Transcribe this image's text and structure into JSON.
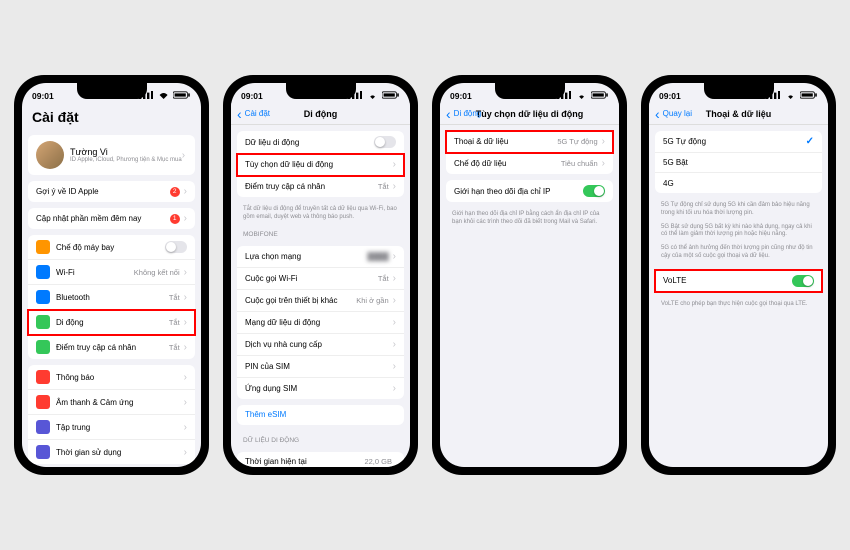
{
  "status": {
    "time": "09:01"
  },
  "phone1": {
    "title": "Cài đặt",
    "profile": {
      "name": "Tường Vi",
      "sub": "ID Apple, iCloud, Phương tiện & Mục mua"
    },
    "suggest": {
      "label": "Gợi ý về ID Apple",
      "badge": "2"
    },
    "update": {
      "label": "Cập nhật phần mềm đêm nay",
      "badge": "1"
    },
    "items": [
      {
        "label": "Chế độ máy bay",
        "icon_bg": "#ff9500"
      },
      {
        "label": "Wi-Fi",
        "detail": "Không kết nối",
        "icon_bg": "#007aff"
      },
      {
        "label": "Bluetooth",
        "detail": "Tắt",
        "icon_bg": "#007aff"
      },
      {
        "label": "Di động",
        "detail": "Tắt",
        "icon_bg": "#34c759",
        "highlight": true
      },
      {
        "label": "Điểm truy cập cá nhân",
        "detail": "Tắt",
        "icon_bg": "#34c759"
      }
    ],
    "items2": [
      {
        "label": "Thông báo",
        "icon_bg": "#ff3b30"
      },
      {
        "label": "Âm thanh & Cảm ứng",
        "icon_bg": "#ff3b30"
      },
      {
        "label": "Tập trung",
        "icon_bg": "#5856d6"
      },
      {
        "label": "Thời gian sử dụng",
        "icon_bg": "#5856d6"
      }
    ]
  },
  "phone2": {
    "back": "Cài đặt",
    "title": "Di động",
    "items_top": [
      {
        "label": "Dữ liệu di động",
        "toggle": false
      },
      {
        "label": "Tùy chọn dữ liệu di động",
        "highlight": true
      },
      {
        "label": "Điểm truy cập cá nhân",
        "detail": "Tắt"
      }
    ],
    "foot1": "Tắt dữ liệu di động để truyền tất cả dữ liệu qua Wi-Fi, bao gồm email, duyệt web và thông báo push.",
    "section": "MOBIFONE",
    "items_mob": [
      {
        "label": "Lựa chọn mạng",
        "blur": true
      },
      {
        "label": "Cuộc gọi Wi-Fi",
        "detail": "Tắt"
      },
      {
        "label": "Cuộc gọi trên thiết bị khác",
        "detail": "Khi ở gần"
      },
      {
        "label": "Mạng dữ liệu di động"
      },
      {
        "label": "Dịch vụ nhà cung cấp"
      },
      {
        "label": "PIN của SIM"
      },
      {
        "label": "Ứng dụng SIM"
      }
    ],
    "esim": "Thêm eSIM",
    "section2": "DỮ LIỆU DI ĐỘNG",
    "usage": {
      "label": "Thời gian hiện tại",
      "detail": "22,0 GB"
    }
  },
  "phone3": {
    "back": "Di động",
    "title": "Tùy chọn dữ liệu di động",
    "items": [
      {
        "label": "Thoại & dữ liệu",
        "detail": "5G Tự động",
        "highlight": true
      },
      {
        "label": "Chế độ dữ liệu",
        "detail": "Tiêu chuẩn"
      }
    ],
    "roam": {
      "label": "Giới hạn theo dõi địa chỉ IP",
      "toggle": true
    },
    "foot": "Giới hạn theo dõi địa chỉ IP bằng cách ẩn địa chỉ IP của bạn khỏi các trình theo dõi đã biết trong Mail và Safari."
  },
  "phone4": {
    "back": "Quay lại",
    "title": "Thoại & dữ liệu",
    "options": [
      {
        "label": "5G Tự động",
        "checked": true
      },
      {
        "label": "5G Bật"
      },
      {
        "label": "4G"
      }
    ],
    "foot1": "5G Tự động chỉ sử dụng 5G khi cần đảm bảo hiệu năng trong khi tối ưu hóa thời lượng pin.",
    "foot2": "5G Bật sử dụng 5G bất kỳ khi nào khả dụng, ngay cả khi có thể làm giảm thời lượng pin hoặc hiệu năng.",
    "foot3": "5G có thể ảnh hưởng đến thời lượng pin cũng như độ tin cậy của một số cuộc gọi thoại và dữ liệu.",
    "volte": {
      "label": "VoLTE",
      "toggle": true,
      "highlight": true
    },
    "foot4": "VoLTE cho phép bạn thực hiện cuộc gọi thoại qua LTE."
  }
}
